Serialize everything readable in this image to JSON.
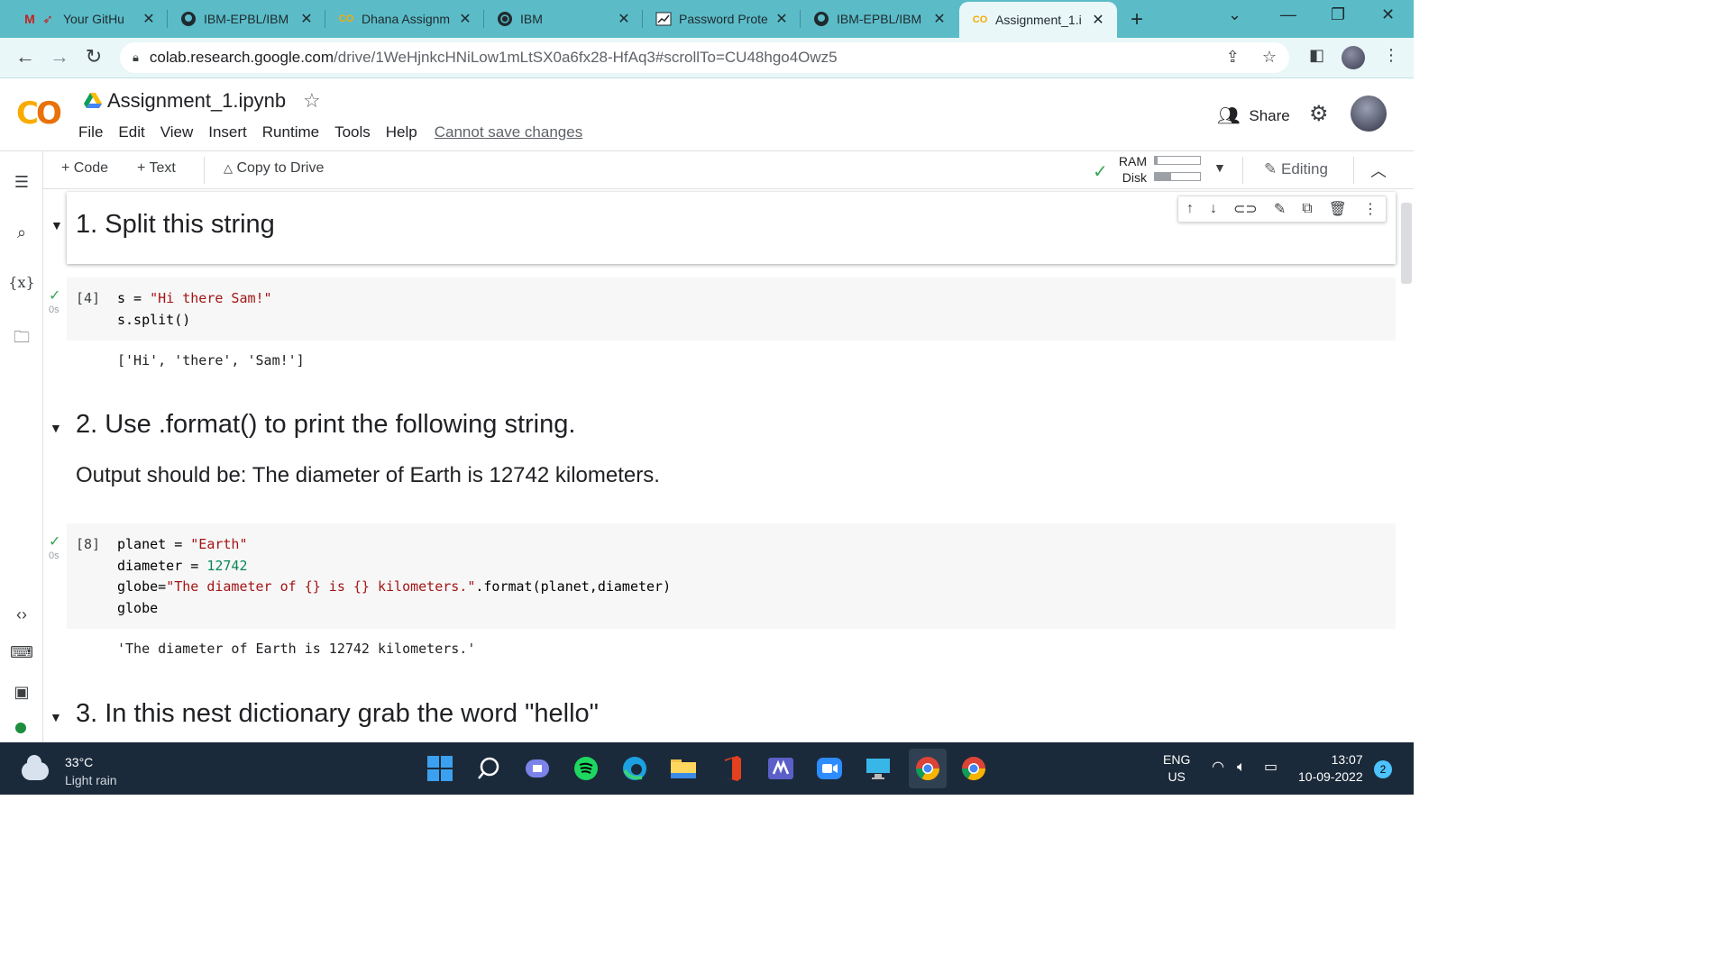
{
  "browser": {
    "tabs": [
      {
        "title": "Your GitHu",
        "icon": "gmail-icon"
      },
      {
        "title": "IBM-EPBL/IBM",
        "icon": "github-icon"
      },
      {
        "title": "Dhana Assignm",
        "icon": "colab-icon"
      },
      {
        "title": "IBM",
        "icon": "globe-icon"
      },
      {
        "title": "Password Prote",
        "icon": "chart-icon"
      },
      {
        "title": "IBM-EPBL/IBM",
        "icon": "github-icon"
      },
      {
        "title": "Assignment_1.i",
        "icon": "colab-icon"
      }
    ],
    "url_host": "colab.research.google.com",
    "url_path": "/drive/1WeHjnkcHNiLow1mLtSX0a6fx28-HfAq3#scrollTo=CU48hgo4Owz5"
  },
  "colab": {
    "notebook_title": "Assignment_1.ipynb",
    "menu": [
      "File",
      "Edit",
      "View",
      "Insert",
      "Runtime",
      "Tools",
      "Help"
    ],
    "cannot_save": "Cannot save changes",
    "share_label": "Share",
    "toolbar": {
      "code": "+ Code",
      "text": "+ Text",
      "copy_drive": "Copy to Drive",
      "ram": "RAM",
      "disk": "Disk",
      "editing": "Editing"
    },
    "ram_fraction": 0.05,
    "disk_fraction": 0.35
  },
  "cells": {
    "h1": "1. Split this string",
    "c1": {
      "count": "[4]",
      "time": "0s",
      "line1_a": "s = ",
      "line1_b": "\"Hi there Sam!\"",
      "line2": "s.split()",
      "output": "['Hi', 'there', 'Sam!']"
    },
    "h2": "2. Use .format() to print the following string.",
    "p2": "Output should be: The diameter of Earth is 12742 kilometers.",
    "c2": {
      "count": "[8]",
      "time": "0s",
      "l1a": "planet = ",
      "l1b": "\"Earth\"",
      "l2a": "diameter = ",
      "l2b": "12742",
      "l3a": "globe=",
      "l3b": "\"The diameter of {} is {} kilometers.\"",
      "l3c": ".format(planet,diameter)",
      "l4": "globe",
      "output": "'The diameter of Earth is 12742 kilometers.'"
    },
    "h3": "3. In this nest dictionary grab the word \"hello\""
  },
  "taskbar": {
    "temp": "33°C",
    "weather": "Light rain",
    "lang1": "ENG",
    "lang2": "US",
    "time": "13:07",
    "date": "10-09-2022",
    "notifications": "2"
  }
}
